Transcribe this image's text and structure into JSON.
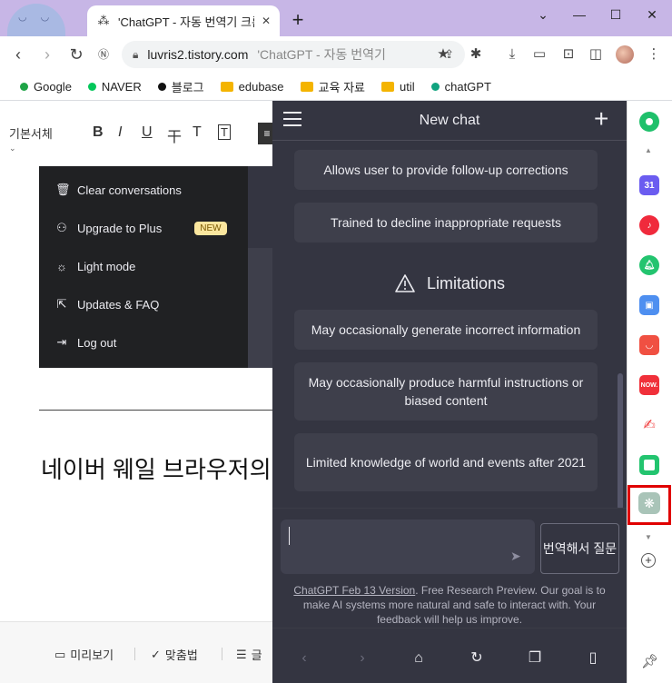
{
  "browser": {
    "tab_title": "'ChatGPT - 자동 번역기 크롬 확",
    "new_tab": "+",
    "minimize": "⌄",
    "min": "—",
    "max": "☐",
    "close": "✕",
    "url": "luvris2.tistory.com",
    "page_title": "'ChatGPT - 자동 번역기",
    "bookmarks": [
      {
        "label": "Google",
        "color": "#1ea446"
      },
      {
        "label": "NAVER",
        "color": "#03c75a"
      },
      {
        "label": "블로그",
        "color": "#111111"
      },
      {
        "label": "edubase",
        "color": "folder"
      },
      {
        "label": "교육 자료",
        "color": "folder"
      },
      {
        "label": "util",
        "color": "folder"
      },
      {
        "label": "chatGPT",
        "color": "#10a37f"
      }
    ]
  },
  "editor": {
    "font_select": "기본서체",
    "format_bold": "B",
    "format_italic": "I",
    "format_underline": "U",
    "format_strike": "干",
    "format_color": "T",
    "format_bg": "T",
    "menu": {
      "clear": "Clear conversations",
      "upgrade": "Upgrade to Plus",
      "new_badge": "NEW",
      "light": "Light mode",
      "updates": "Updates & FAQ",
      "logout": "Log out"
    },
    "heading": "네이버 웨일 브라우저의",
    "bottom": {
      "preview": "미리보기",
      "spell": "맞춤법",
      "more": "글"
    }
  },
  "chat": {
    "title": "New chat",
    "cards_top": [
      "Allows user to provide follow-up corrections",
      "Trained to decline inappropriate requests"
    ],
    "limitations_title": "Limitations",
    "limitations": [
      "May occasionally generate incorrect information",
      "May occasionally produce harmful instructions or biased content",
      "Limited knowledge of world and events after 2021"
    ],
    "translate_button": "번역해서 질문",
    "footnote_link": "ChatGPT Feb 13 Version",
    "footnote_text": ". Free Research Preview. Our goal is to make AI systems more natural and safe to interact with. Your feedback will help us improve."
  },
  "sidebar": {
    "calendar_day": "31",
    "now_label": "NOW."
  }
}
